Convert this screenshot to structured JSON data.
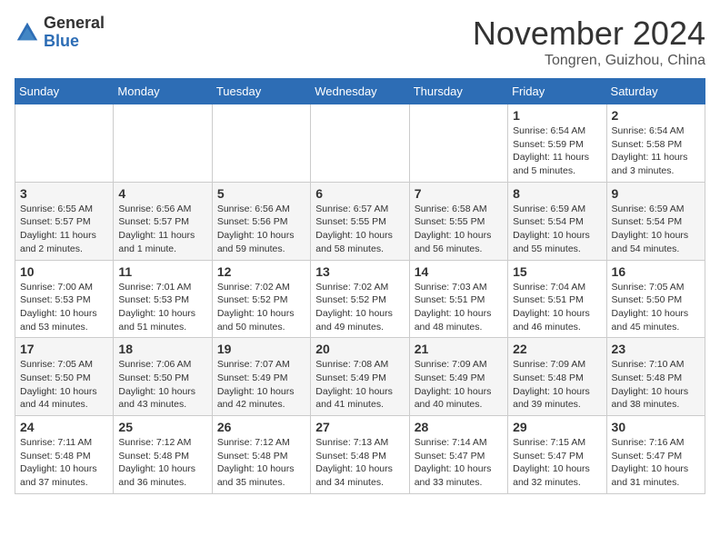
{
  "header": {
    "logo_general": "General",
    "logo_blue": "Blue",
    "month_title": "November 2024",
    "location": "Tongren, Guizhou, China"
  },
  "days_of_week": [
    "Sunday",
    "Monday",
    "Tuesday",
    "Wednesday",
    "Thursday",
    "Friday",
    "Saturday"
  ],
  "weeks": [
    [
      {
        "day": "",
        "info": ""
      },
      {
        "day": "",
        "info": ""
      },
      {
        "day": "",
        "info": ""
      },
      {
        "day": "",
        "info": ""
      },
      {
        "day": "",
        "info": ""
      },
      {
        "day": "1",
        "info": "Sunrise: 6:54 AM\nSunset: 5:59 PM\nDaylight: 11 hours and 5 minutes."
      },
      {
        "day": "2",
        "info": "Sunrise: 6:54 AM\nSunset: 5:58 PM\nDaylight: 11 hours and 3 minutes."
      }
    ],
    [
      {
        "day": "3",
        "info": "Sunrise: 6:55 AM\nSunset: 5:57 PM\nDaylight: 11 hours and 2 minutes."
      },
      {
        "day": "4",
        "info": "Sunrise: 6:56 AM\nSunset: 5:57 PM\nDaylight: 11 hours and 1 minute."
      },
      {
        "day": "5",
        "info": "Sunrise: 6:56 AM\nSunset: 5:56 PM\nDaylight: 10 hours and 59 minutes."
      },
      {
        "day": "6",
        "info": "Sunrise: 6:57 AM\nSunset: 5:55 PM\nDaylight: 10 hours and 58 minutes."
      },
      {
        "day": "7",
        "info": "Sunrise: 6:58 AM\nSunset: 5:55 PM\nDaylight: 10 hours and 56 minutes."
      },
      {
        "day": "8",
        "info": "Sunrise: 6:59 AM\nSunset: 5:54 PM\nDaylight: 10 hours and 55 minutes."
      },
      {
        "day": "9",
        "info": "Sunrise: 6:59 AM\nSunset: 5:54 PM\nDaylight: 10 hours and 54 minutes."
      }
    ],
    [
      {
        "day": "10",
        "info": "Sunrise: 7:00 AM\nSunset: 5:53 PM\nDaylight: 10 hours and 53 minutes."
      },
      {
        "day": "11",
        "info": "Sunrise: 7:01 AM\nSunset: 5:53 PM\nDaylight: 10 hours and 51 minutes."
      },
      {
        "day": "12",
        "info": "Sunrise: 7:02 AM\nSunset: 5:52 PM\nDaylight: 10 hours and 50 minutes."
      },
      {
        "day": "13",
        "info": "Sunrise: 7:02 AM\nSunset: 5:52 PM\nDaylight: 10 hours and 49 minutes."
      },
      {
        "day": "14",
        "info": "Sunrise: 7:03 AM\nSunset: 5:51 PM\nDaylight: 10 hours and 48 minutes."
      },
      {
        "day": "15",
        "info": "Sunrise: 7:04 AM\nSunset: 5:51 PM\nDaylight: 10 hours and 46 minutes."
      },
      {
        "day": "16",
        "info": "Sunrise: 7:05 AM\nSunset: 5:50 PM\nDaylight: 10 hours and 45 minutes."
      }
    ],
    [
      {
        "day": "17",
        "info": "Sunrise: 7:05 AM\nSunset: 5:50 PM\nDaylight: 10 hours and 44 minutes."
      },
      {
        "day": "18",
        "info": "Sunrise: 7:06 AM\nSunset: 5:50 PM\nDaylight: 10 hours and 43 minutes."
      },
      {
        "day": "19",
        "info": "Sunrise: 7:07 AM\nSunset: 5:49 PM\nDaylight: 10 hours and 42 minutes."
      },
      {
        "day": "20",
        "info": "Sunrise: 7:08 AM\nSunset: 5:49 PM\nDaylight: 10 hours and 41 minutes."
      },
      {
        "day": "21",
        "info": "Sunrise: 7:09 AM\nSunset: 5:49 PM\nDaylight: 10 hours and 40 minutes."
      },
      {
        "day": "22",
        "info": "Sunrise: 7:09 AM\nSunset: 5:48 PM\nDaylight: 10 hours and 39 minutes."
      },
      {
        "day": "23",
        "info": "Sunrise: 7:10 AM\nSunset: 5:48 PM\nDaylight: 10 hours and 38 minutes."
      }
    ],
    [
      {
        "day": "24",
        "info": "Sunrise: 7:11 AM\nSunset: 5:48 PM\nDaylight: 10 hours and 37 minutes."
      },
      {
        "day": "25",
        "info": "Sunrise: 7:12 AM\nSunset: 5:48 PM\nDaylight: 10 hours and 36 minutes."
      },
      {
        "day": "26",
        "info": "Sunrise: 7:12 AM\nSunset: 5:48 PM\nDaylight: 10 hours and 35 minutes."
      },
      {
        "day": "27",
        "info": "Sunrise: 7:13 AM\nSunset: 5:48 PM\nDaylight: 10 hours and 34 minutes."
      },
      {
        "day": "28",
        "info": "Sunrise: 7:14 AM\nSunset: 5:47 PM\nDaylight: 10 hours and 33 minutes."
      },
      {
        "day": "29",
        "info": "Sunrise: 7:15 AM\nSunset: 5:47 PM\nDaylight: 10 hours and 32 minutes."
      },
      {
        "day": "30",
        "info": "Sunrise: 7:16 AM\nSunset: 5:47 PM\nDaylight: 10 hours and 31 minutes."
      }
    ]
  ]
}
